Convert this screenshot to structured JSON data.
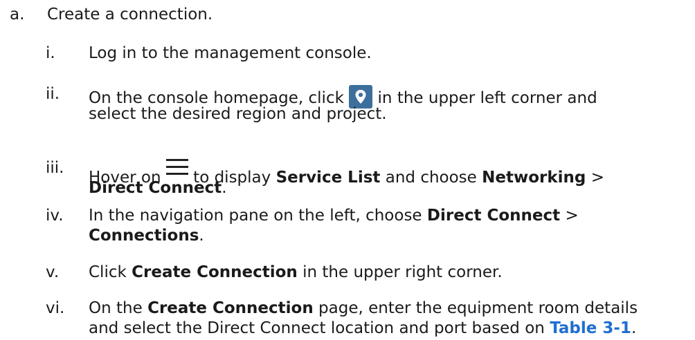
{
  "step_a": {
    "marker": "a.",
    "text": "Create a connection."
  },
  "substeps": [
    {
      "marker": "i.",
      "text": "Log in to the management console."
    },
    {
      "marker": "ii.",
      "line1_pre": "On the console homepage, click",
      "line1_post": "in the upper left corner and",
      "line2": "select the desired region and project."
    },
    {
      "marker": "iii.",
      "pre": "Hover on",
      "mid1": "to display",
      "bold1": "Service List",
      "mid2": "and choose",
      "bold2": "Networking",
      "sep": ">",
      "bold3": "Direct Connect",
      "end": "."
    },
    {
      "marker": "iv.",
      "pre": "In the navigation pane on the left, choose",
      "bold1": "Direct Connect",
      "sep": ">",
      "bold2": "Connections",
      "end": "."
    },
    {
      "marker": "v.",
      "pre": "Click",
      "bold1": "Create Connection",
      "post": "in the upper right corner."
    },
    {
      "marker": "vi.",
      "pre": "On the",
      "bold1": "Create Connection",
      "post": "page, enter the equipment room details",
      "line2_pre": "and select the Direct Connect location and port based on",
      "link": "Table 3-1",
      "end": "."
    }
  ],
  "icons": {
    "region": "location-pin-icon",
    "menu": "hamburger-menu-icon"
  },
  "colors": {
    "text": "#1a1a1a",
    "link": "#1f6fd1",
    "region_icon_bg": "#3d6f9c"
  }
}
